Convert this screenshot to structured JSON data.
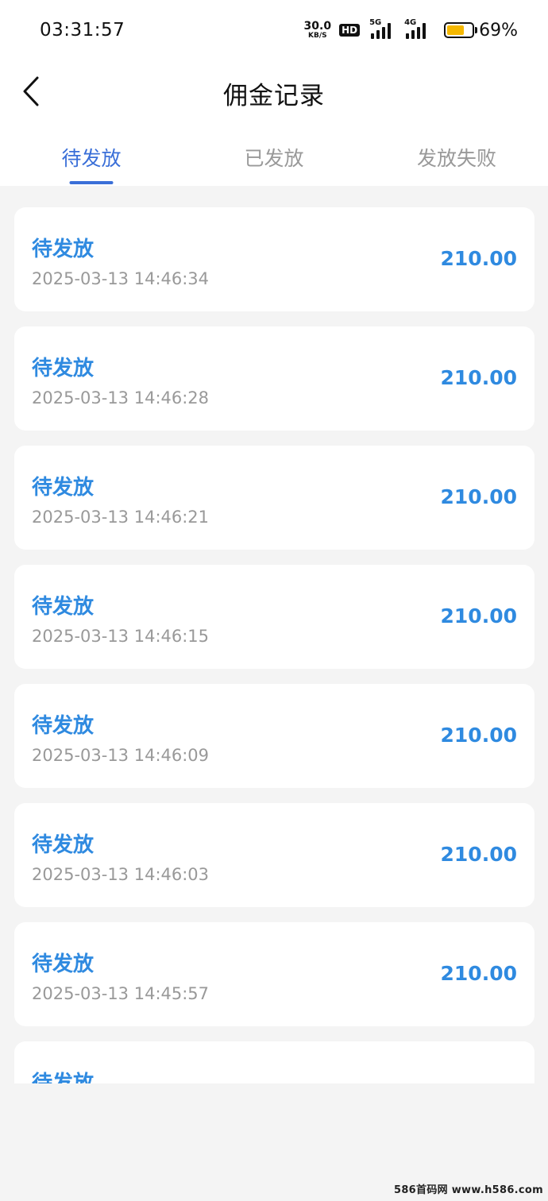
{
  "status_bar": {
    "time": "03:31:57",
    "net_speed_value": "30.0",
    "net_speed_unit": "KB/S",
    "hd": "HD",
    "signal1_label": "5G",
    "signal2_label": "4G",
    "battery_level": 0.69,
    "battery_pct": "69%"
  },
  "header": {
    "title": "佣金记录"
  },
  "tabs": [
    {
      "label": "待发放",
      "active": true
    },
    {
      "label": "已发放",
      "active": false
    },
    {
      "label": "发放失败",
      "active": false
    }
  ],
  "records": [
    {
      "status": "待发放",
      "time": "2025-03-13 14:46:34",
      "amount": "210.00"
    },
    {
      "status": "待发放",
      "time": "2025-03-13 14:46:28",
      "amount": "210.00"
    },
    {
      "status": "待发放",
      "time": "2025-03-13 14:46:21",
      "amount": "210.00"
    },
    {
      "status": "待发放",
      "time": "2025-03-13 14:46:15",
      "amount": "210.00"
    },
    {
      "status": "待发放",
      "time": "2025-03-13 14:46:09",
      "amount": "210.00"
    },
    {
      "status": "待发放",
      "time": "2025-03-13 14:46:03",
      "amount": "210.00"
    },
    {
      "status": "待发放",
      "time": "2025-03-13 14:45:57",
      "amount": "210.00"
    },
    {
      "status": "待发放",
      "time": "",
      "amount": ""
    }
  ],
  "watermark": "586首码网 www.h586.com",
  "colors": {
    "accent": "#3a6fd8",
    "amount": "#2f8ae0",
    "battery": "#f5b800",
    "background": "#f4f4f4"
  },
  "icons": {
    "back": "chevron-left-icon"
  }
}
